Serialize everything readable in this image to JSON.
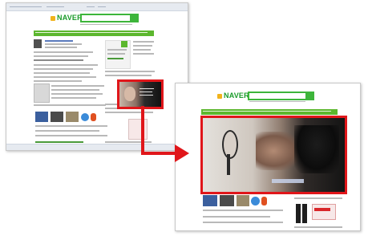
{
  "left_window": {
    "logo": "NAVER"
  },
  "right_window": {
    "logo": "NAVER"
  },
  "colors": {
    "accent": "#e0161a",
    "brand": "#1a9b2a",
    "nav_green": "#5cb72e"
  },
  "icons": [
    "naver-logo-icon",
    "arrow-right-icon",
    "mirror-video-frame"
  ]
}
